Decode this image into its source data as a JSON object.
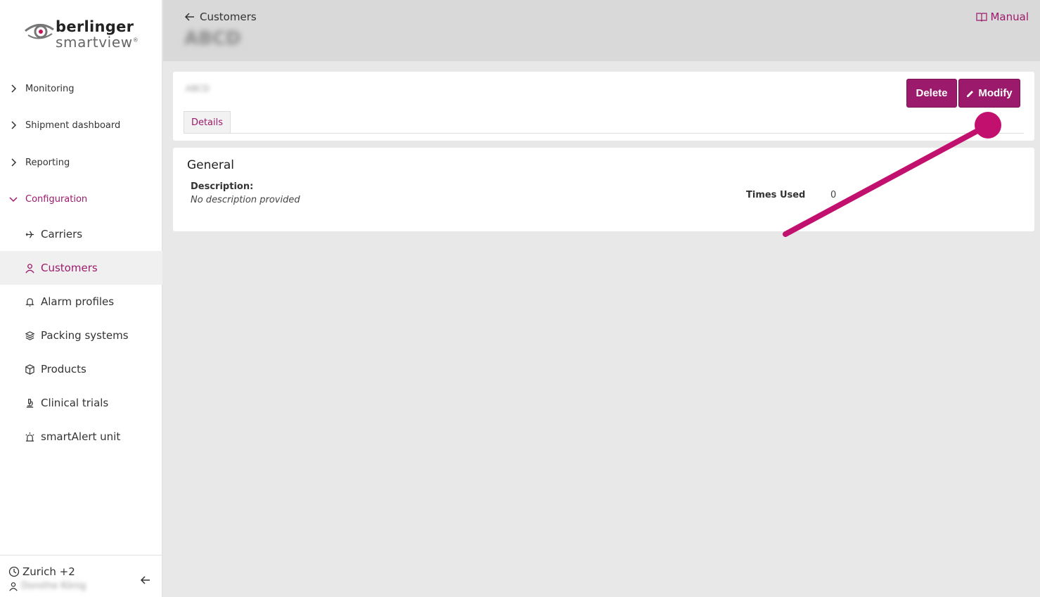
{
  "brand": {
    "line1": "berlinger",
    "line2": "smartview",
    "accent_color": "#9c1a6b"
  },
  "sidebar": {
    "groups": [
      {
        "label": "Monitoring",
        "icon": "chevron-right-icon"
      },
      {
        "label": "Shipment dashboard",
        "icon": "chevron-right-icon"
      },
      {
        "label": "Reporting",
        "icon": "chevron-right-icon"
      },
      {
        "label": "Configuration",
        "icon": "chevron-down-icon"
      }
    ],
    "items": [
      {
        "label": "Carriers",
        "icon": "airplane-icon"
      },
      {
        "label": "Customers",
        "icon": "person-icon"
      },
      {
        "label": "Alarm profiles",
        "icon": "bell-icon"
      },
      {
        "label": "Packing systems",
        "icon": "layers-icon"
      },
      {
        "label": "Products",
        "icon": "box-icon"
      },
      {
        "label": "Clinical trials",
        "icon": "microscope-icon"
      },
      {
        "label": "smartAlert unit",
        "icon": "siren-icon"
      }
    ],
    "footer": {
      "timezone": "Zurich +2",
      "user": "Dorothe König"
    }
  },
  "header": {
    "back_label": "Customers",
    "title": "ABCD",
    "manual_label": "Manual"
  },
  "detail": {
    "subtitle": "ABCD",
    "delete_label": "Delete",
    "modify_label": "Modify",
    "tab_label": "Details"
  },
  "general": {
    "title": "General",
    "description_label": "Description:",
    "description_value": "No description provided",
    "times_used_label": "Times Used",
    "times_used_value": "0"
  }
}
